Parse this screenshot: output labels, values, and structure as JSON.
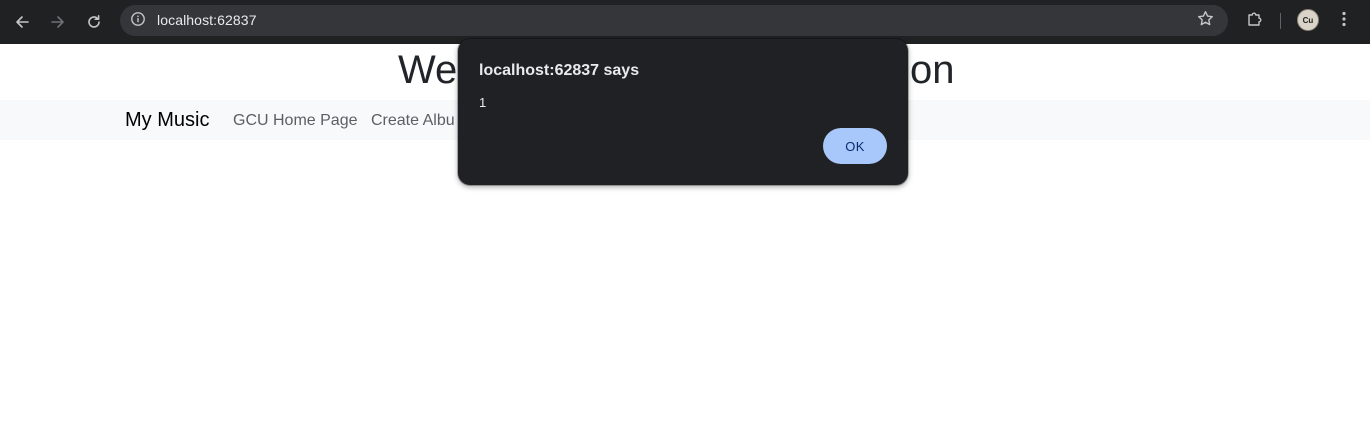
{
  "browser": {
    "url": "localhost:62837",
    "profile_initials": "Cu",
    "colors": {
      "toolbar_bg": "#1f2123",
      "omnibox_bg": "#35363a",
      "icon_color": "#c4c7c5"
    },
    "icons": {
      "back": "arrow-left-icon",
      "forward": "arrow-right-icon",
      "reload": "reload-icon",
      "site_info": "info-icon",
      "bookmark": "star-icon",
      "extensions": "puzzle-icon",
      "menu": "kebab-menu-icon"
    }
  },
  "page": {
    "heading_left_visible": "We",
    "heading_right_visible": "tion",
    "navbar": {
      "brand": "My Music",
      "links": [
        {
          "label": "GCU Home Page"
        },
        {
          "label": "Create Albu"
        }
      ]
    },
    "colors": {
      "navbar_bg": "#f8f9fa",
      "heading": "#212529",
      "link": "#5c5f62"
    }
  },
  "dialog": {
    "title": "localhost:62837 says",
    "message": "1",
    "ok_label": "OK",
    "colors": {
      "bg": "#202124",
      "ok_bg": "#a8c7fa",
      "ok_text": "#062e6f"
    }
  }
}
